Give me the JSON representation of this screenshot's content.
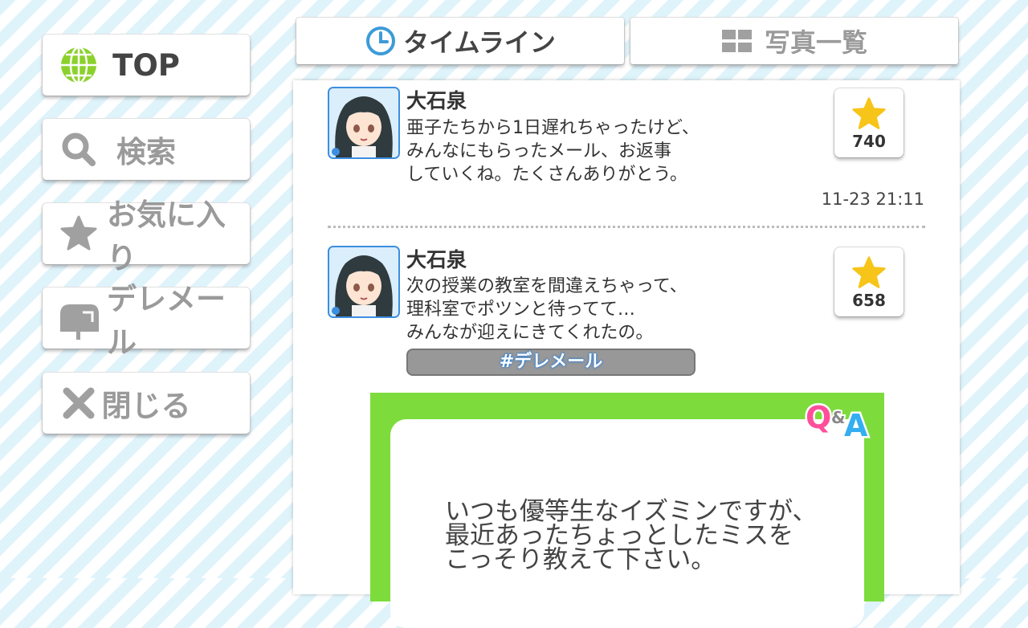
{
  "sidebar": {
    "items": [
      {
        "label": "TOP",
        "icon": "globe-icon"
      },
      {
        "label": "検索",
        "icon": "search-icon"
      },
      {
        "label": "お気に入り",
        "icon": "star-icon"
      },
      {
        "label": "デレメール",
        "icon": "mailbox-icon"
      },
      {
        "label": "閉じる",
        "icon": "close-icon"
      }
    ]
  },
  "tabs": [
    {
      "label": "タイムライン",
      "icon": "clock-icon",
      "active": true
    },
    {
      "label": "写真一覧",
      "icon": "grid-icon",
      "active": false
    }
  ],
  "timeline": {
    "posts": [
      {
        "name": "大石泉",
        "lines": [
          "亜子たちから1日遅れちゃったけど、",
          "みんなにもらったメール、お返事",
          "していくね。たくさんありがとう。"
        ],
        "likes": "740",
        "time": "11-23 21:11"
      },
      {
        "name": "大石泉",
        "lines": [
          "次の授業の教室を間違えちゃって、",
          "理科室でポツンと待ってて…",
          "みんなが迎えにきてくれたの。"
        ],
        "likes": "658",
        "hashtag": "#デレメール"
      }
    ],
    "qa": {
      "logo_q": "Q",
      "logo_amp": "&",
      "logo_a": "A",
      "lines": [
        "いつも優等生なイズミンですが、",
        "最近あったちょっとしたミスを",
        "こっそり教えて下さい。"
      ]
    }
  },
  "colors": {
    "accent_blue": "#3c8ee0",
    "qa_green": "#7ddc3c",
    "star_yellow": "#f7c419",
    "stripe_blue": "#dff3fb"
  }
}
